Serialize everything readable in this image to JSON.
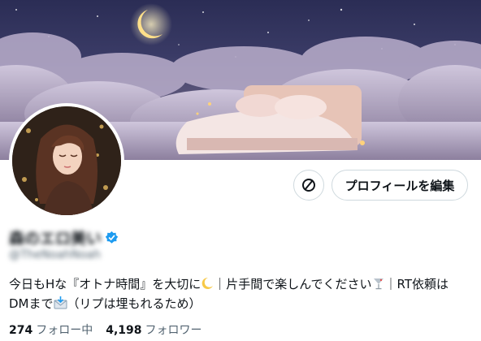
{
  "profile": {
    "display_name": "森のエロ美い",
    "handle": "@TheNoahNoah",
    "bio_line1": "今日もHな『オトナ時間』を大切に",
    "bio_line1b": "｜片手間で楽しんでください",
    "bio_line1c": "｜RT依頼は",
    "bio_line2a": "DMまで",
    "bio_line2b": "（リプは埋もれるため）",
    "following_count": "274",
    "following_label": "フォロー中",
    "followers_count": "4,198",
    "followers_label": "フォロワー"
  },
  "actions": {
    "edit_profile_label": "プロフィールを編集"
  },
  "icons": {
    "moon": "crescent-moon-emoji",
    "cocktail": "cocktail-glass-emoji",
    "inbox": "incoming-envelope-emoji",
    "action": "slash-circle-icon",
    "verified": "verified-badge-icon"
  },
  "colors": {
    "accent": "#1d9bf0",
    "banner_sky": "#2b2d55",
    "text": "#0f1419",
    "muted": "#536471"
  }
}
